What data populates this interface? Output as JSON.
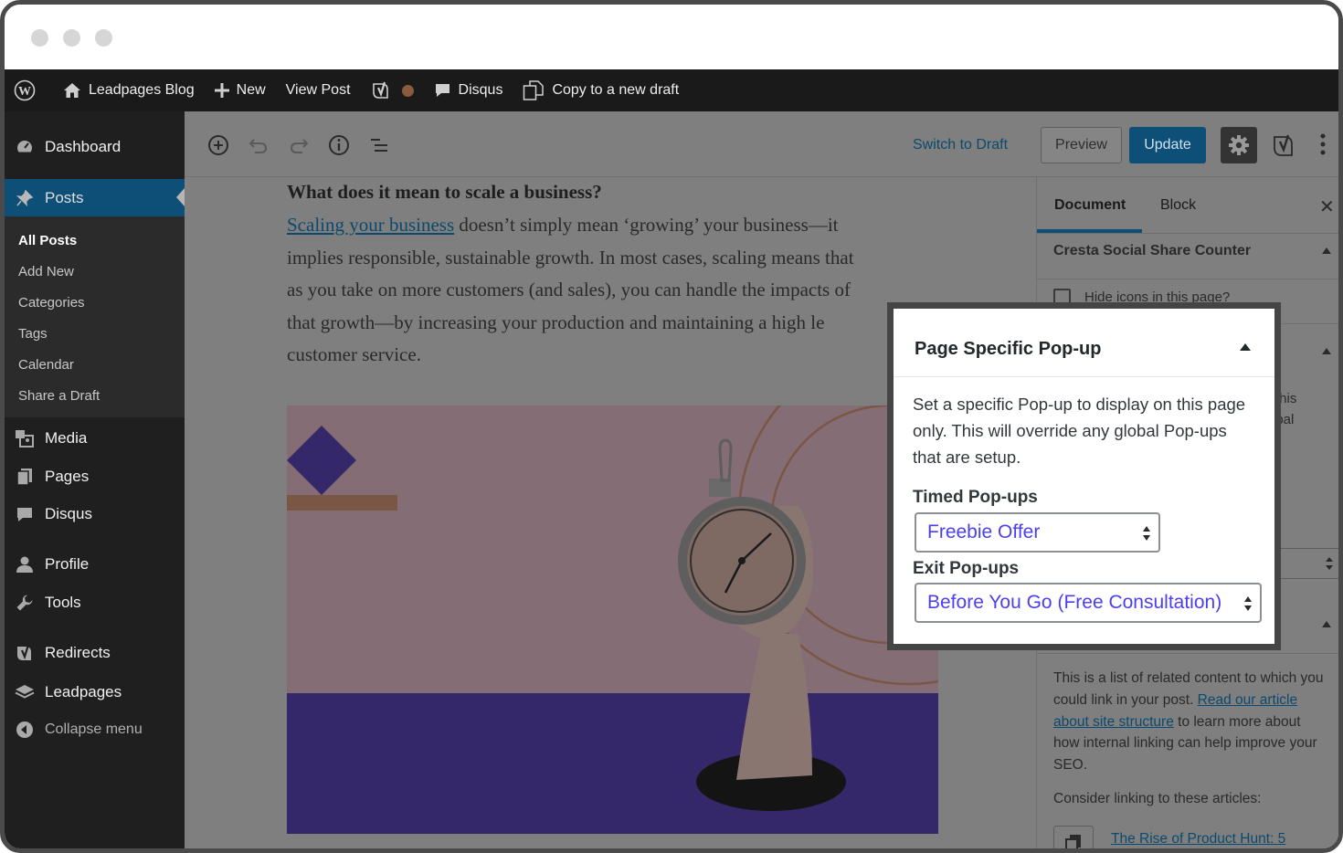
{
  "adminbar": {
    "site_name": "Leadpages Blog",
    "new_label": "New",
    "view_post_label": "View Post",
    "disqus_label": "Disqus",
    "copy_draft_label": "Copy to a new draft"
  },
  "sidebar": {
    "items": {
      "dashboard": "Dashboard",
      "posts": "Posts",
      "media": "Media",
      "pages": "Pages",
      "disqus": "Disqus",
      "profile": "Profile",
      "tools": "Tools",
      "redirects": "Redirects",
      "leadpages": "Leadpages",
      "collapse": "Collapse menu"
    },
    "submenu": {
      "all_posts": "All Posts",
      "add_new": "Add New",
      "categories": "Categories",
      "tags": "Tags",
      "calendar": "Calendar",
      "share_draft": "Share a Draft"
    }
  },
  "toolbar": {
    "switch_to_draft": "Switch to Draft",
    "preview": "Preview",
    "update": "Update"
  },
  "content": {
    "heading": "What does it mean to scale a business?",
    "link_text": "Scaling your business",
    "line1": " doesn’t simply mean ‘growing’ your business—it",
    "line2": "implies responsible, sustainable growth. In most cases, scaling means that",
    "line3": "as you take on more customers (and sales), you can handle the impacts of",
    "line4": "that growth—by increasing your production and maintaining a high le",
    "line5": "customer service."
  },
  "panel": {
    "tab_document": "Document",
    "tab_block": "Block",
    "close_glyph": "✕",
    "social_title": "Cresta Social Share Counter",
    "hide_icons": "Hide icons in this page?",
    "frag_this": "this",
    "frag_obal": "obal",
    "links_intro": "This is a list of related content to which you could link in your post.",
    "links_read": "Read our article about site structure",
    "links_rest": " to learn more about how internal linking can help improve your SEO.",
    "consider": "Consider linking to these articles:",
    "related_link": "The Rise of Product Hunt: 5"
  },
  "popup": {
    "title": "Page Specific Pop-up",
    "description": "Set a specific Pop-up to display on this page only. This will override any global Pop-ups that are setup.",
    "timed_label": "Timed Pop-ups",
    "timed_value": "Freebie Offer",
    "exit_label": "Exit Pop-ups",
    "exit_value": "Before You Go (Free Consultation)"
  },
  "colors": {
    "accent": "#0e4f78",
    "select_text": "#4b3ff0",
    "hero_purple": "#35286a"
  }
}
